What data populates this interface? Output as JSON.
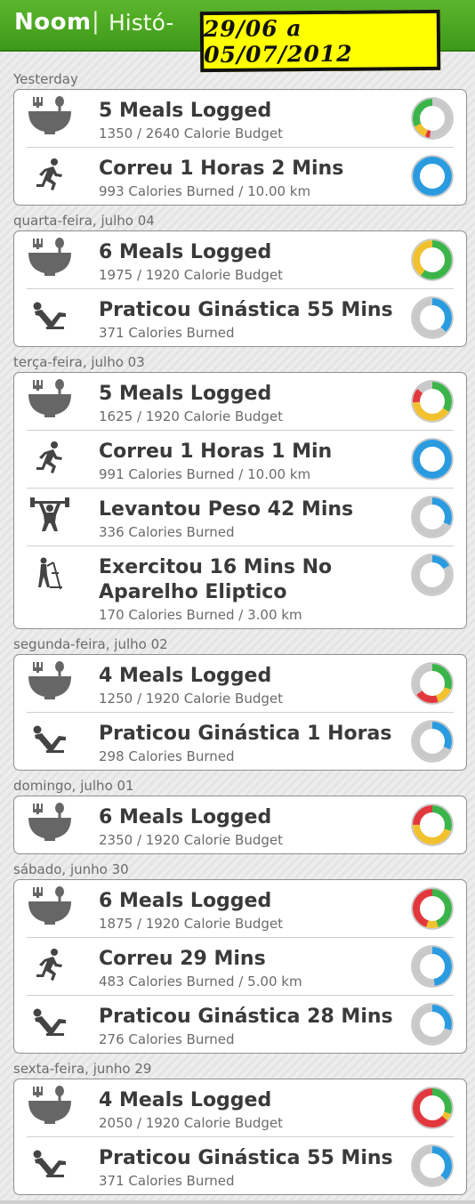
{
  "header": {
    "brand": "Noom",
    "separator": "|",
    "title": "Histó-"
  },
  "date_sticker": "29/06 a 05/07/2012",
  "colors": {
    "green": "#3bb54a",
    "yellow": "#f2c12e",
    "red": "#e2383d",
    "blue": "#2b9be0",
    "gray": "#c9c9c9"
  },
  "days": [
    {
      "label": "Yesterday",
      "entries": [
        {
          "icon": "meals-bowl-icon",
          "title": "5 Meals Logged",
          "subtitle": "1350 / 2640 Calorie Budget",
          "ring": [
            [
              "gray",
              0.52
            ],
            [
              "red",
              0.04
            ],
            [
              "yellow",
              0.12
            ],
            [
              "green",
              0.32
            ]
          ]
        },
        {
          "icon": "runner-icon",
          "title": "Correu 1 Horas 2 Mins",
          "subtitle": "993 Calories Burned / 10.00 km",
          "ring": [
            [
              "blue",
              1.0
            ]
          ]
        }
      ]
    },
    {
      "label": "quarta-feira, julho 04",
      "entries": [
        {
          "icon": "meals-bowl-icon",
          "title": "6 Meals Logged",
          "subtitle": "1975 / 1920 Calorie Budget",
          "ring": [
            [
              "green",
              0.6
            ],
            [
              "yellow",
              0.4
            ]
          ]
        },
        {
          "icon": "situp-icon",
          "title": "Praticou Ginástica 55 Mins",
          "subtitle": "371 Calories Burned",
          "ring": [
            [
              "blue",
              0.38
            ],
            [
              "gray",
              0.62
            ]
          ]
        }
      ]
    },
    {
      "label": "terça-feira, julho 03",
      "entries": [
        {
          "icon": "meals-bowl-icon",
          "title": "5 Meals Logged",
          "subtitle": "1625 / 1920 Calorie Budget",
          "ring": [
            [
              "green",
              0.34
            ],
            [
              "yellow",
              0.4
            ],
            [
              "red",
              0.12
            ],
            [
              "gray",
              0.14
            ]
          ]
        },
        {
          "icon": "runner-icon",
          "title": "Correu 1 Horas 1 Min",
          "subtitle": "991 Calories Burned / 10.00 km",
          "ring": [
            [
              "blue",
              1.0
            ]
          ]
        },
        {
          "icon": "weightlifting-icon",
          "title": "Levantou Peso 42 Mins",
          "subtitle": "336 Calories Burned",
          "ring": [
            [
              "blue",
              0.32
            ],
            [
              "gray",
              0.68
            ]
          ]
        },
        {
          "icon": "elliptical-icon",
          "title": "Exercitou 16 Mins No Aparelho Eliptico",
          "subtitle": "170 Calories Burned / 3.00 km",
          "ring": [
            [
              "blue",
              0.17
            ],
            [
              "gray",
              0.83
            ]
          ]
        }
      ]
    },
    {
      "label": "segunda-feira, julho 02",
      "entries": [
        {
          "icon": "meals-bowl-icon",
          "title": "4 Meals Logged",
          "subtitle": "1250 / 1920 Calorie Budget",
          "ring": [
            [
              "green",
              0.3
            ],
            [
              "yellow",
              0.15
            ],
            [
              "red",
              0.2
            ],
            [
              "gray",
              0.35
            ]
          ]
        },
        {
          "icon": "situp-icon",
          "title": "Praticou Ginástica 1 Horas",
          "subtitle": "298 Calories Burned",
          "ring": [
            [
              "blue",
              0.32
            ],
            [
              "gray",
              0.68
            ]
          ]
        }
      ]
    },
    {
      "label": "domingo, julho 01",
      "entries": [
        {
          "icon": "meals-bowl-icon",
          "title": "6 Meals Logged",
          "subtitle": "2350 / 1920 Calorie Budget",
          "ring": [
            [
              "green",
              0.3
            ],
            [
              "yellow",
              0.45
            ],
            [
              "red",
              0.25
            ]
          ]
        }
      ]
    },
    {
      "label": "sábado, junho 30",
      "entries": [
        {
          "icon": "meals-bowl-icon",
          "title": "6 Meals Logged",
          "subtitle": "1875 / 1920 Calorie Budget",
          "ring": [
            [
              "green",
              0.45
            ],
            [
              "yellow",
              0.1
            ],
            [
              "red",
              0.45
            ]
          ]
        },
        {
          "icon": "runner-icon",
          "title": "Correu 29 Mins",
          "subtitle": "483 Calories Burned / 5.00 km",
          "ring": [
            [
              "blue",
              0.48
            ],
            [
              "gray",
              0.52
            ]
          ]
        },
        {
          "icon": "situp-icon",
          "title": "Praticou Ginástica 28 Mins",
          "subtitle": "276 Calories Burned",
          "ring": [
            [
              "blue",
              0.3
            ],
            [
              "gray",
              0.7
            ]
          ]
        }
      ]
    },
    {
      "label": "sexta-feira, junho 29",
      "entries": [
        {
          "icon": "meals-bowl-icon",
          "title": "4 Meals Logged",
          "subtitle": "2050 / 1920 Calorie Budget",
          "ring": [
            [
              "green",
              0.3
            ],
            [
              "yellow",
              0.06
            ],
            [
              "red",
              0.64
            ]
          ]
        },
        {
          "icon": "situp-icon",
          "title": "Praticou Ginástica 55 Mins",
          "subtitle": "371 Calories Burned",
          "ring": [
            [
              "blue",
              0.38
            ],
            [
              "gray",
              0.62
            ]
          ]
        }
      ]
    }
  ]
}
